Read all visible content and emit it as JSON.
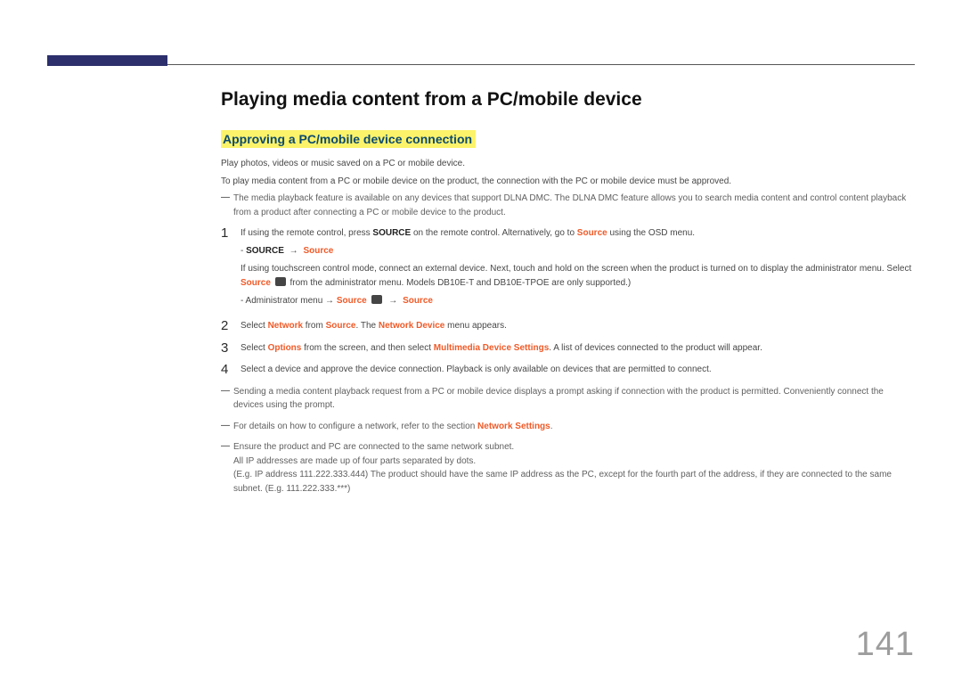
{
  "page_number": "141",
  "title": "Playing media content from a PC/mobile device",
  "subtitle": "Approving a PC/mobile device connection",
  "intro1": "Play photos, videos or music saved on a PC or mobile device.",
  "intro2": "To play media content from a PC or mobile device on the product, the connection with the PC or mobile device must be approved.",
  "top_note": "The media playback feature is available on any devices that support DLNA DMC. The DLNA DMC feature allows you to search media content and control content playback from a product after connecting a PC or mobile device to the product.",
  "step1": {
    "num": "1",
    "pre": "If using the remote control, press ",
    "bold1": "SOURCE",
    "mid1": " on the remote control. Alternatively, go to ",
    "orange1": "Source",
    "post1": " using the OSD menu.",
    "sub_prefix": "- ",
    "sub_bold": "SOURCE",
    "sub_arrow": " → ",
    "sub_orange": "Source",
    "line2a": "If using touchscreen control mode, connect an external device. Next, touch and hold on the screen when the product is turned on to display the administrator menu. Select ",
    "line2_orange": "Source",
    "line2b": " from the administrator menu. Models DB10E-T and DB10E-TPOE are only supported.)",
    "sub2_prefix": "- Administrator menu → ",
    "sub2_o1": "Source",
    "sub2_arrow": " → ",
    "sub2_o2": "Source"
  },
  "step2": {
    "num": "2",
    "a": "Select ",
    "o1": "Network",
    "b": " from ",
    "o2": "Source",
    "c": ". The ",
    "o3": "Network Device",
    "d": " menu appears."
  },
  "step3": {
    "num": "3",
    "a": "Select ",
    "o1": "Options",
    "b": " from the screen, and then select ",
    "o2": "Multimedia Device Settings",
    "c": ". A list of devices connected to the product will appear."
  },
  "step4": {
    "num": "4",
    "text": "Select a device and approve the device connection. Playback is only available on devices that are permitted to connect."
  },
  "bottom_notes": {
    "n1": "Sending a media content playback request from a PC or mobile device displays a prompt asking if connection with the product is permitted. Conveniently connect the devices using the prompt.",
    "n2_pre": "For details on how to configure a network, refer to the section ",
    "n2_orange": "Network Settings",
    "n2_post": ".",
    "n3": "Ensure the product and PC are connected to the same network subnet.",
    "n3_sub1": "All IP addresses are made up of four parts separated by dots.",
    "n3_sub2": "(E.g. IP address 111.222.333.444) The product should have the same IP address as the PC, except for the fourth part of the address, if they are connected to the same subnet. (E.g. 111.222.333.***)"
  }
}
